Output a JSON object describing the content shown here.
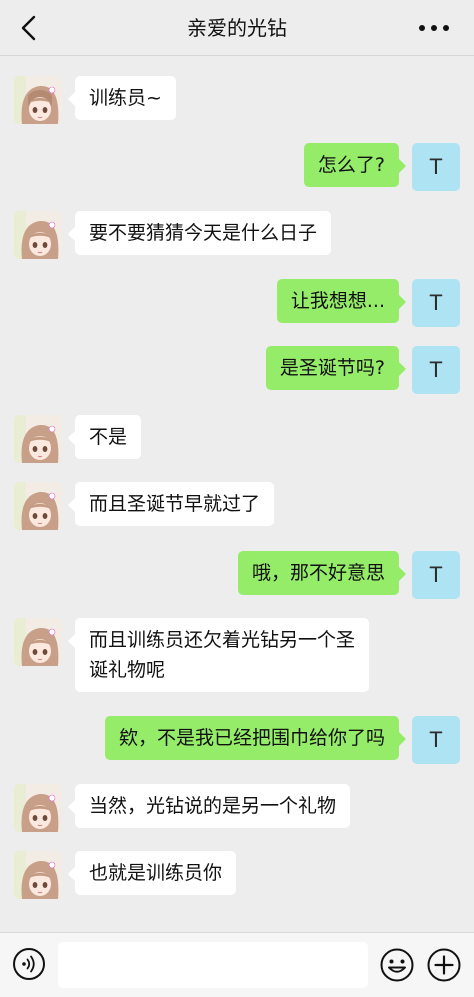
{
  "header": {
    "title": "亲爱的光钻",
    "back_icon": "chevron-left-icon",
    "more_icon": "more-dots-icon"
  },
  "contact": {
    "avatar_desc": "anime-girl-avatar"
  },
  "self": {
    "avatar_letter": "T",
    "avatar_color": "#aee3f4"
  },
  "colors": {
    "self_bubble": "#95ec69",
    "other_bubble": "#ffffff",
    "background": "#ededed"
  },
  "messages": [
    {
      "side": "left",
      "text": "训练员~"
    },
    {
      "side": "right",
      "text": "怎么了?"
    },
    {
      "side": "left",
      "text": "要不要猜猜今天是什么日子"
    },
    {
      "side": "right",
      "text": "让我想想..."
    },
    {
      "side": "right",
      "text": "是圣诞节吗?"
    },
    {
      "side": "left",
      "text": "不是"
    },
    {
      "side": "left",
      "text": "而且圣诞节早就过了"
    },
    {
      "side": "right",
      "text": "哦，那不好意思"
    },
    {
      "side": "left",
      "text": "而且训练员还欠着光钻另一个圣\n诞礼物呢"
    },
    {
      "side": "right",
      "text": "欸，不是我已经把围巾给你了吗"
    },
    {
      "side": "left",
      "text": "当然，光钻说的是另一个礼物"
    },
    {
      "side": "left",
      "text": "也就是训练员你"
    }
  ],
  "input_bar": {
    "value": "",
    "voice_icon": "voice-icon",
    "emoji_icon": "emoji-icon",
    "plus_icon": "plus-icon"
  }
}
